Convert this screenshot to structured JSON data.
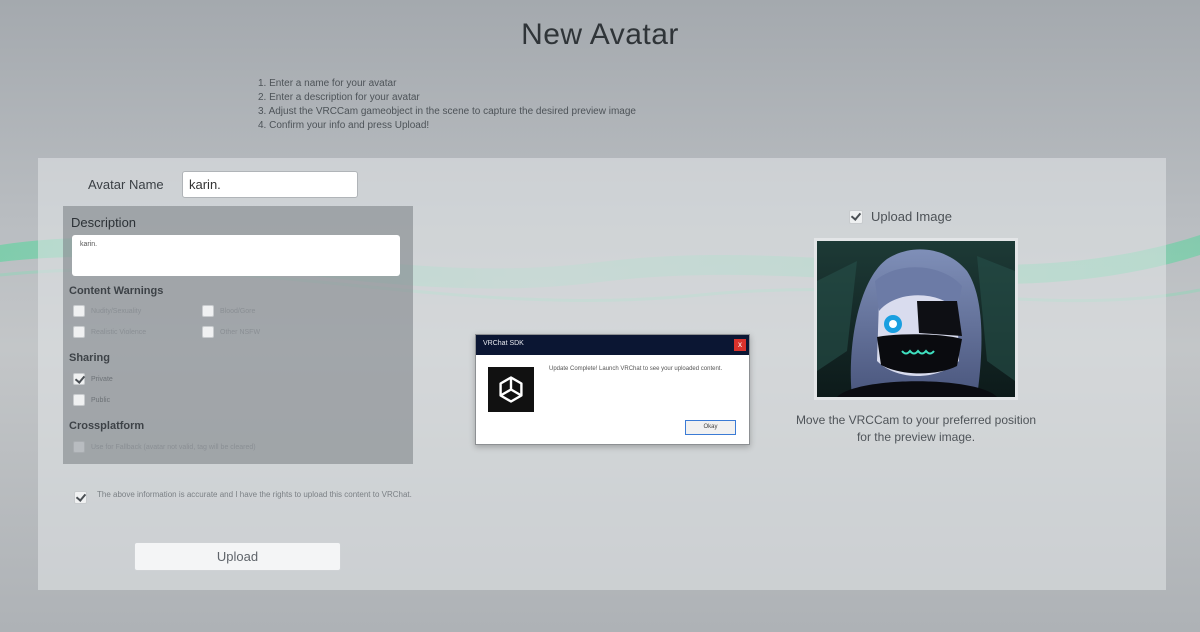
{
  "header": {
    "title": "New Avatar"
  },
  "instructions": [
    "1. Enter a name for your avatar",
    "2. Enter a description for your avatar",
    "3. Adjust the VRCCam gameobject in the scene to capture the desired preview image",
    "4. Confirm your info and press Upload!"
  ],
  "form": {
    "name_label": "Avatar Name",
    "name_value": "karin.",
    "description_label": "Description",
    "description_value": "karin."
  },
  "content_warnings": {
    "heading": "Content Warnings",
    "items": [
      {
        "label": "Nudity/Sexuality",
        "checked": false
      },
      {
        "label": "Blood/Gore",
        "checked": false
      },
      {
        "label": "Realistic Violence",
        "checked": false
      },
      {
        "label": "Other NSFW",
        "checked": false
      }
    ]
  },
  "sharing": {
    "heading": "Sharing",
    "items": [
      {
        "label": "Private",
        "checked": true
      },
      {
        "label": "Public",
        "checked": false
      }
    ]
  },
  "crossplatform": {
    "heading": "Crossplatform",
    "fallback_label": "Use for Fallback (avatar not valid, tag will be cleared)",
    "checked": false
  },
  "agreement": {
    "text": "The above information is accurate and I have the rights to upload this content to VRChat.",
    "checked": true
  },
  "upload_button": "Upload",
  "upload_image": {
    "label": "Upload Image",
    "checked": true
  },
  "preview_caption": "Move the VRCCam to your preferred position for the preview image.",
  "dialog": {
    "title": "VRChat SDK",
    "close": "x",
    "message": "Update Complete! Launch VRChat to see your uploaded content.",
    "ok_label": "Okay"
  },
  "colors": {
    "dialog_titlebar": "#0b1633",
    "close_button": "#d9322c",
    "wave_accent": "#4fd79a"
  }
}
